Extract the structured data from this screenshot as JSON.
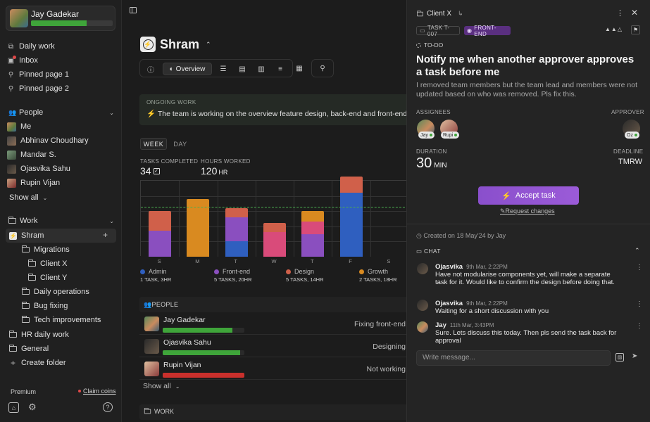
{
  "colors": {
    "accent_purple": "#9b5bd8",
    "green": "#3fa53a",
    "red": "#c9302c",
    "admin": "#2f5fbf",
    "frontend": "#8a4fbf",
    "design": "#d0604a",
    "growth": "#d98a20",
    "pink": "#d94b7a"
  },
  "user": {
    "name": "Jay Gadekar",
    "progress": 0.68
  },
  "sidebar": {
    "top_items": [
      {
        "label": "Daily work",
        "icon": "daily-work-icon"
      },
      {
        "label": "Inbox",
        "icon": "inbox-icon",
        "badge": true
      },
      {
        "label": "Pinned page 1",
        "icon": "pin-icon"
      },
      {
        "label": "Pinned page 2",
        "icon": "pin-icon"
      }
    ],
    "people_label": "People",
    "people": [
      {
        "label": "Me"
      },
      {
        "label": "Abhinav Choudhary"
      },
      {
        "label": "Mandar S."
      },
      {
        "label": "Ojasvika Sahu"
      },
      {
        "label": "Rupin Vijan"
      }
    ],
    "show_all": "Show all",
    "work_label": "Work",
    "work_items": [
      {
        "label": "Shram",
        "level": 0
      },
      {
        "label": "Migrations",
        "level": 1
      },
      {
        "label": "Client X",
        "level": 2
      },
      {
        "label": "Client Y",
        "level": 2
      },
      {
        "label": "Daily operations",
        "level": 1
      },
      {
        "label": "Bug fixing",
        "level": 1
      },
      {
        "label": "Tech improvements",
        "level": 1
      },
      {
        "label": "HR daily work",
        "level": 0
      },
      {
        "label": "General",
        "level": 0
      }
    ],
    "create_folder": "Create folder",
    "plan": "Premium",
    "claim": "Claim coins"
  },
  "main": {
    "title": "Shram",
    "overview_tab": "Overview",
    "ongoing_label": "ONGOING WORK",
    "ongoing_text": "The team is working on the overview feature design, back-end and front-end",
    "seg_week": "WEEK",
    "seg_day": "DAY",
    "stats": {
      "tasks_label": "TASKS COMPLETED",
      "tasks_value": "34",
      "hours_label": "HOURS WORKED",
      "hours_value": "120",
      "hours_unit": "HR"
    },
    "legend": [
      {
        "name": "Admin",
        "sub": "1 TASK, 3HR",
        "color": "#2f5fbf"
      },
      {
        "name": "Front-end",
        "sub": "5 TASKS, 20HR",
        "color": "#8a4fbf"
      },
      {
        "name": "Design",
        "sub": "5 TASKS, 14HR",
        "color": "#d0604a"
      },
      {
        "name": "Growth",
        "sub": "2 TASKS, 18HR",
        "color": "#d98a20"
      }
    ],
    "people_label": "PEOPLE",
    "people": [
      {
        "name": "Jay Gadekar",
        "status": "Fixing front-end",
        "bar": 0.85,
        "bar_color": "#3fa53a"
      },
      {
        "name": "Ojasvika Sahu",
        "status": "Designing",
        "bar": 0.95,
        "bar_color": "#3fa53a"
      },
      {
        "name": "Rupin Vijan",
        "status": "Not working",
        "bar": 1.0,
        "bar_color": "#c9302c"
      }
    ],
    "show_all": "Show all",
    "work_label": "WORK"
  },
  "chart_data": {
    "type": "bar",
    "stacked": true,
    "categories": [
      "S",
      "M",
      "T",
      "W",
      "T",
      "F",
      "S"
    ],
    "series": [
      {
        "name": "Admin",
        "color": "#2f5fbf",
        "values": [
          0,
          0,
          1,
          0,
          0,
          4.2,
          0
        ]
      },
      {
        "name": "Front-end",
        "color": "#8a4fbf",
        "values": [
          1.7,
          0,
          1.6,
          0,
          1.5,
          0,
          0
        ]
      },
      {
        "name": "Pink",
        "color": "#d94b7a",
        "values": [
          0,
          0,
          0,
          1.6,
          0.8,
          0,
          0
        ]
      },
      {
        "name": "Design",
        "color": "#d0604a",
        "values": [
          1.3,
          0,
          0.6,
          0.6,
          0,
          1.1,
          0
        ]
      },
      {
        "name": "Growth",
        "color": "#d98a20",
        "values": [
          0,
          3.8,
          0,
          0,
          0.7,
          0,
          0
        ]
      }
    ],
    "ylim": [
      0,
      5
    ],
    "target_line": 3.3,
    "grid": true
  },
  "panel": {
    "breadcrumb": "Client X",
    "task_id": "TASK T-007",
    "tag": "FRONT-END",
    "status": "TO-DO",
    "title": "Notify me when another approver approves a task before me",
    "description": "I removed team members but the team lead and members were not updated based on who was removed. Pls fix this.",
    "assignees_label": "ASSIGNEES",
    "assignees": [
      "Jay",
      "Rupi"
    ],
    "approver_label": "APPROVER",
    "approver": "Oz",
    "duration_label": "DURATION",
    "duration_value": "30",
    "duration_unit": "MIN",
    "deadline_label": "DEADLINE",
    "deadline_value": "TMRW",
    "accept": "Accept task",
    "request": "Request changes",
    "created": "Created on 18 May'24 by Jay",
    "chat_label": "CHAT",
    "messages": [
      {
        "name": "Ojasvika",
        "time": "9th Mar, 2:22PM",
        "text": "Have not modularise components yet, will make a separate task for it. Would like to confirm the design before doing that."
      },
      {
        "name": "Ojasvika",
        "time": "9th Mar, 2:22PM",
        "text": "Waiting for a short discussion with you"
      },
      {
        "name": "Jay",
        "time": "11th Mar, 3:43PM",
        "text": "Sure. Lets discuss this today. Then pls send the task back for approval"
      }
    ],
    "input_placeholder": "Write message..."
  }
}
